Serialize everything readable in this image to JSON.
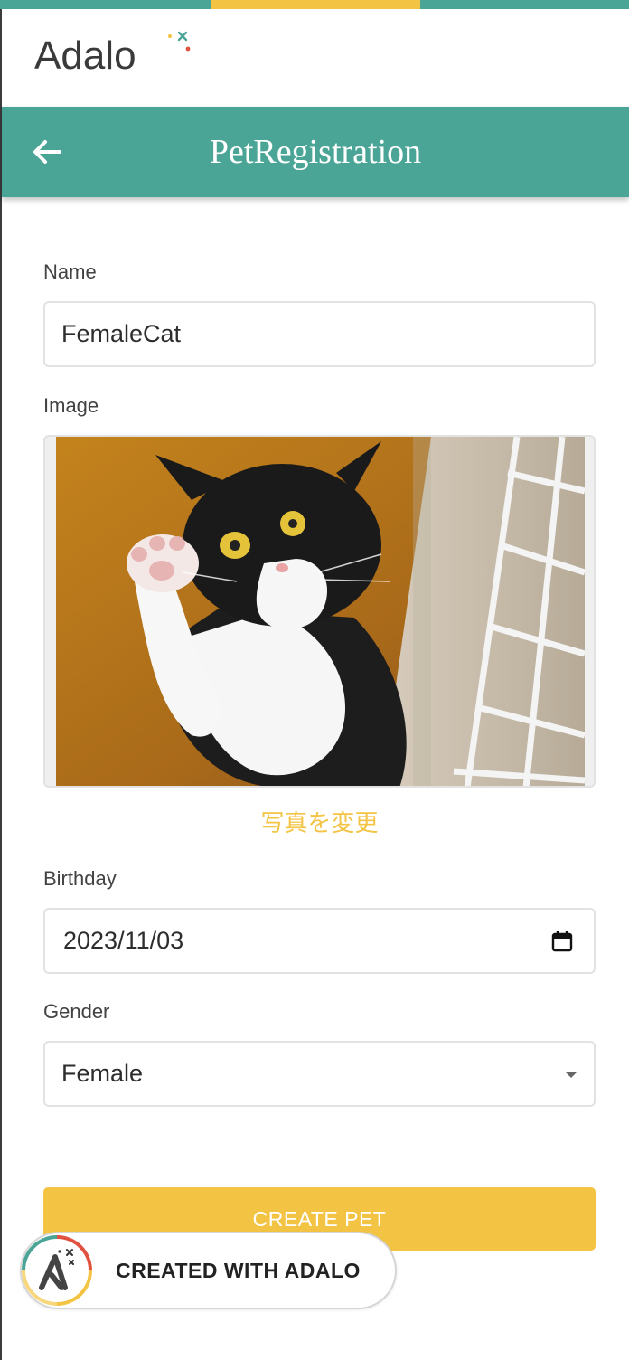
{
  "brand": {
    "logo_text": "Adalo",
    "teal": "#4aa596",
    "yellow": "#f3c444"
  },
  "header": {
    "title": "PetRegistration",
    "back_icon": "arrow-left-icon"
  },
  "form": {
    "name": {
      "label": "Name",
      "value": "FemaleCat"
    },
    "image": {
      "label": "Image",
      "change_link": "写真を変更"
    },
    "birthday": {
      "label": "Birthday",
      "value": "2023/11/03",
      "icon": "calendar-icon"
    },
    "gender": {
      "label": "Gender",
      "value": "Female",
      "icon": "caret-down-icon"
    }
  },
  "actions": {
    "create_label": "CREATE PET"
  },
  "badge": {
    "text": "CREATED WITH ADALO"
  }
}
